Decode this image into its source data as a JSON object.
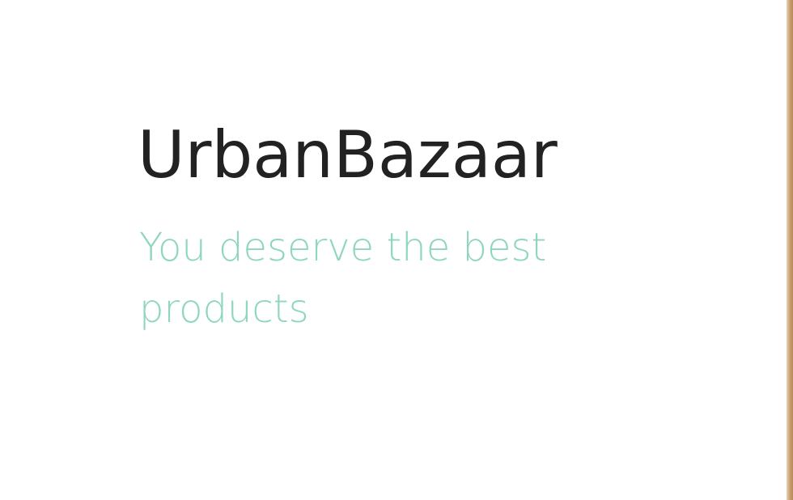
{
  "brand": {
    "name": "UrbanBazaar",
    "tagline": "You deserve the best products"
  },
  "colors": {
    "title": "#222222",
    "tagline": "#8fd6c1",
    "edge": "#c49a68",
    "background": "#ffffff"
  }
}
